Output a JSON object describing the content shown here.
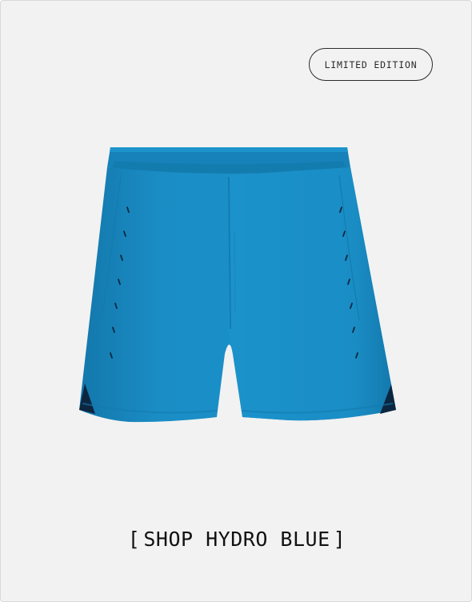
{
  "badge": {
    "label": "LIMITED EDITION"
  },
  "product": {
    "image_alt": "shorts-product-image",
    "color": "#1a8fc7",
    "accent_color": "#0d2640"
  },
  "cta": {
    "open_bracket": "[",
    "label": "SHOP HYDRO BLUE",
    "close_bracket": "]"
  }
}
